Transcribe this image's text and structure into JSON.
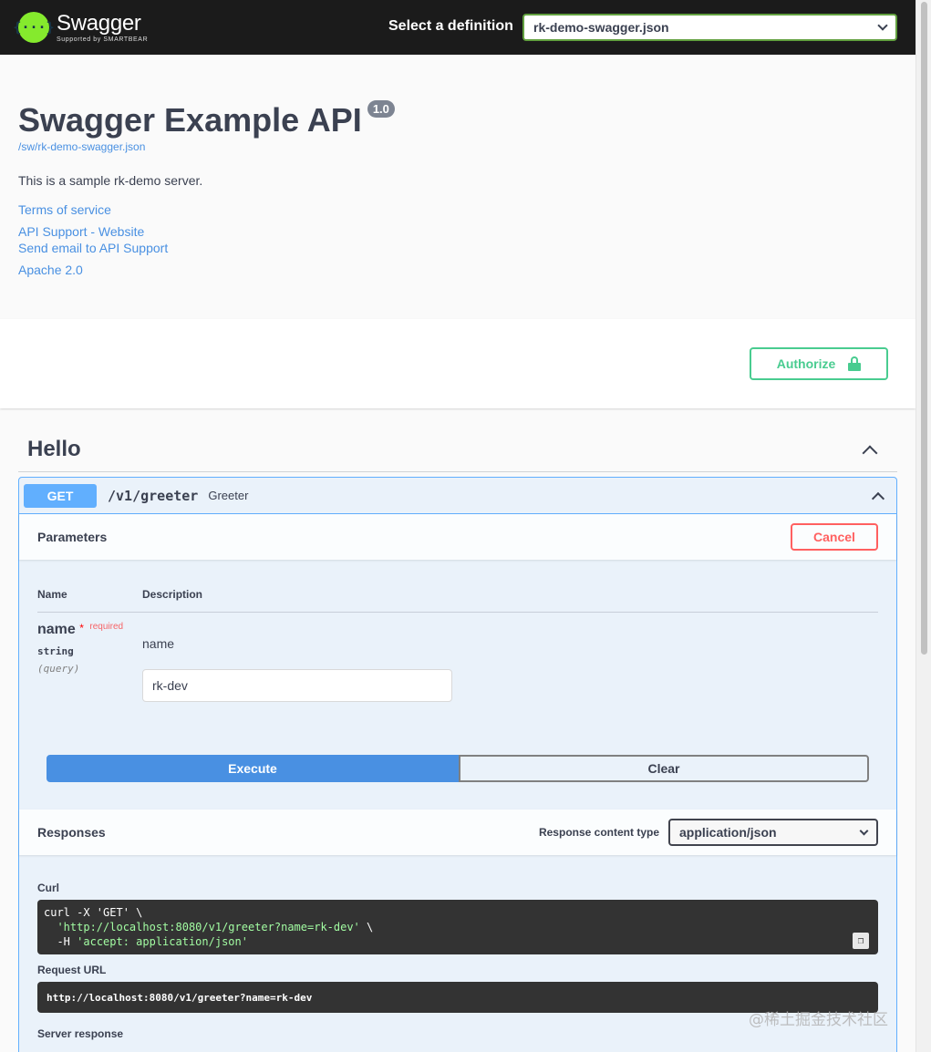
{
  "topbar": {
    "logo_name": "Swagger",
    "logo_sub": "Supported by SMARTBEAR",
    "definition_label": "Select a definition",
    "definition_value": "rk-demo-swagger.json"
  },
  "info": {
    "title": "Swagger Example API",
    "version": "1.0",
    "url": "/sw/rk-demo-swagger.json",
    "description": "This is a sample rk-demo server.",
    "terms": "Terms of service",
    "support_website": "API Support - Website",
    "support_email": "Send email to API Support",
    "license": "Apache 2.0"
  },
  "authorize": {
    "label": "Authorize"
  },
  "tag": {
    "name": "Hello"
  },
  "operation": {
    "method": "GET",
    "path": "/v1/greeter",
    "summary": "Greeter"
  },
  "parameters": {
    "title": "Parameters",
    "cancel_label": "Cancel",
    "col_name": "Name",
    "col_description": "Description",
    "param": {
      "name": "name",
      "required_star": "*",
      "required_label": "required",
      "type": "string",
      "in": "(query)",
      "description": "name",
      "value": "rk-dev"
    },
    "execute_label": "Execute",
    "clear_label": "Clear"
  },
  "responses": {
    "title": "Responses",
    "content_type_label": "Response content type",
    "content_type_value": "application/json",
    "curl_label": "Curl",
    "curl_line1": "curl -X 'GET' \\",
    "curl_line2": "'http://localhost:8080/v1/greeter?name=rk-dev'",
    "curl_line2_suffix": " \\",
    "curl_line3_prefix": "-H ",
    "curl_line3": "'accept: application/json'",
    "request_url_label": "Request URL",
    "request_url": "http://localhost:8080/v1/greeter?name=rk-dev",
    "server_response_label": "Server response"
  },
  "watermark": "@稀土掘金技术社区",
  "colors": {
    "get": "#61affe",
    "authorize": "#49cc90",
    "cancel": "#ff6060",
    "execute": "#4990e2",
    "topbar": "#1b1b1b",
    "logo": "#85ea2d"
  }
}
